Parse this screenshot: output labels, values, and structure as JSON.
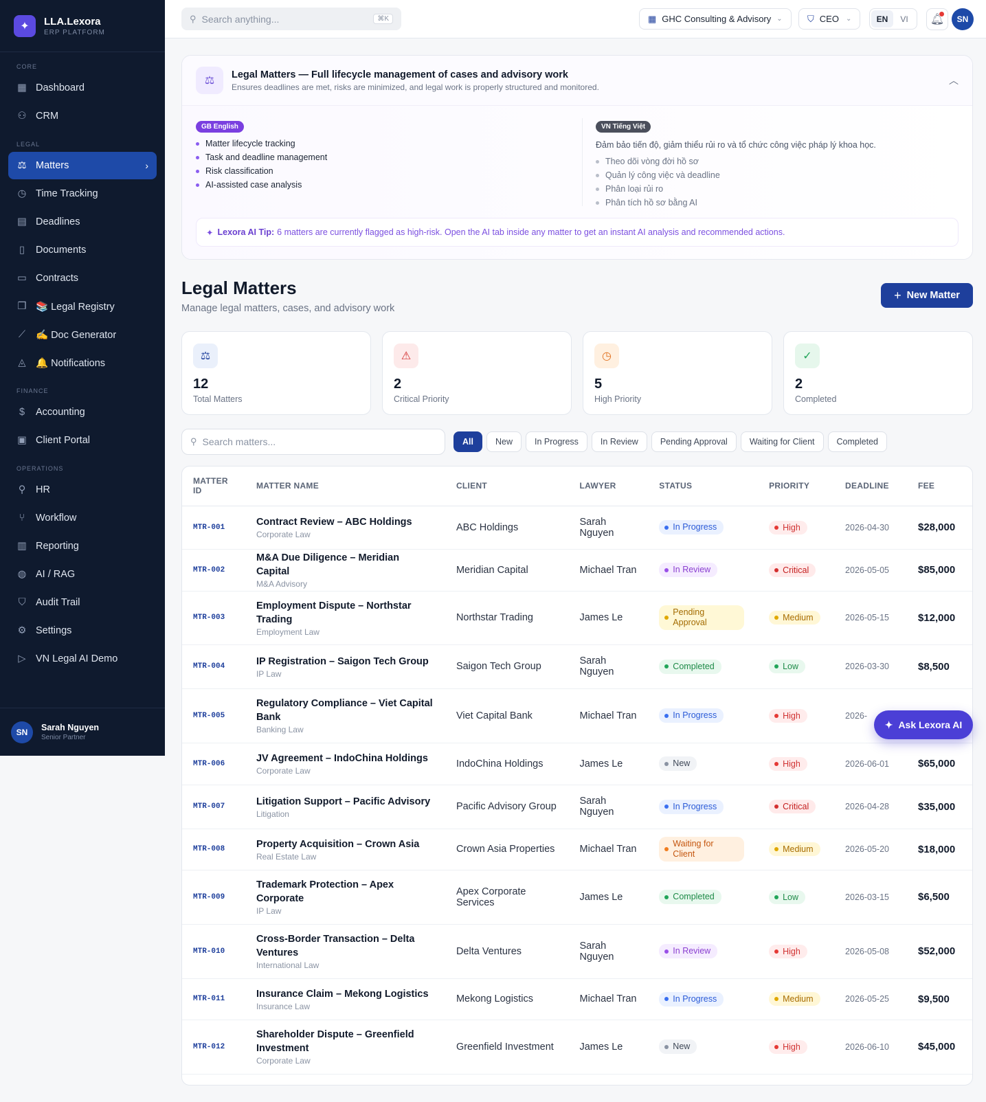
{
  "brand": {
    "name": "LLA.Lexora",
    "sub": "ERP PLATFORM"
  },
  "sidebar": {
    "sections": [
      {
        "title": "CORE",
        "items": [
          {
            "label": "Dashboard",
            "icon": "grid-icon"
          },
          {
            "label": "CRM",
            "icon": "users-icon"
          }
        ]
      },
      {
        "title": "LEGAL",
        "items": [
          {
            "label": "Matters",
            "icon": "scale-icon",
            "active": true
          },
          {
            "label": "Time Tracking",
            "icon": "clock-icon"
          },
          {
            "label": "Deadlines",
            "icon": "calendar-icon"
          },
          {
            "label": "Documents",
            "icon": "document-icon"
          },
          {
            "label": "Contracts",
            "icon": "file-icon"
          },
          {
            "label": "📚 Legal Registry",
            "icon": "book-icon"
          },
          {
            "label": "✍️ Doc Generator",
            "icon": "wand-icon"
          },
          {
            "label": "🔔 Notifications",
            "icon": "bell-icon"
          }
        ]
      },
      {
        "title": "FINANCE",
        "items": [
          {
            "label": "Accounting",
            "icon": "dollar-icon"
          },
          {
            "label": "Client Portal",
            "icon": "portal-icon"
          }
        ]
      },
      {
        "title": "OPERATIONS",
        "items": [
          {
            "label": "HR",
            "icon": "user-icon"
          },
          {
            "label": "Workflow",
            "icon": "workflow-icon"
          },
          {
            "label": "Reporting",
            "icon": "chart-icon"
          },
          {
            "label": "AI / RAG",
            "icon": "brain-icon"
          },
          {
            "label": "Audit Trail",
            "icon": "shield-icon"
          },
          {
            "label": "Settings",
            "icon": "gear-icon"
          },
          {
            "label": "VN Legal AI Demo",
            "icon": "play-icon"
          }
        ]
      }
    ],
    "user": {
      "initials": "SN",
      "name": "Sarah Nguyen",
      "role": "Senior Partner"
    }
  },
  "topbar": {
    "search_placeholder": "Search anything...",
    "shortcut": "⌘K",
    "company": "GHC Consulting & Advisory",
    "role": "CEO",
    "lang_en": "EN",
    "lang_vi": "VI",
    "avatar": "SN"
  },
  "info": {
    "title": "Legal Matters — Full lifecycle management of cases and advisory work",
    "subtitle": "Ensures deadlines are met, risks are minimized, and legal work is properly structured and monitored.",
    "en_badge": "GB English",
    "en_items": [
      "Matter lifecycle tracking",
      "Task and deadline management",
      "Risk classification",
      "AI-assisted case analysis"
    ],
    "vi_badge": "VN Tiếng Việt",
    "vi_intro": "Đảm bảo tiến độ, giảm thiểu rủi ro và tổ chức công việc pháp lý khoa học.",
    "vi_items": [
      "Theo dõi vòng đời hồ sơ",
      "Quản lý công việc và deadline",
      "Phân loại rủi ro",
      "Phân tích hồ sơ bằng AI"
    ],
    "tip_label": "Lexora AI Tip:",
    "tip_text": "6 matters are currently flagged as high-risk. Open the AI tab inside any matter to get an instant AI analysis and recommended actions."
  },
  "page": {
    "title": "Legal Matters",
    "subtitle": "Manage legal matters, cases, and advisory work",
    "new_button": "New Matter"
  },
  "stats": [
    {
      "value": "12",
      "label": "Total Matters"
    },
    {
      "value": "2",
      "label": "Critical Priority"
    },
    {
      "value": "5",
      "label": "High Priority"
    },
    {
      "value": "2",
      "label": "Completed"
    }
  ],
  "filters": {
    "search_placeholder": "Search matters...",
    "chips": [
      "All",
      "New",
      "In Progress",
      "In Review",
      "Pending Approval",
      "Waiting for Client",
      "Completed"
    ]
  },
  "table": {
    "headers": [
      "MATTER ID",
      "MATTER NAME",
      "CLIENT",
      "LAWYER",
      "STATUS",
      "PRIORITY",
      "DEADLINE",
      "FEE"
    ],
    "rows": [
      {
        "id": "MTR-001",
        "name": "Contract Review – ABC Holdings",
        "cat": "Corporate Law",
        "client": "ABC Holdings",
        "lawyer": "Sarah Nguyen",
        "status": "In Progress",
        "priority": "High",
        "deadline": "2026-04-30",
        "fee": "$28,000"
      },
      {
        "id": "MTR-002",
        "name": "M&A Due Diligence – Meridian Capital",
        "cat": "M&A Advisory",
        "client": "Meridian Capital",
        "lawyer": "Michael Tran",
        "status": "In Review",
        "priority": "Critical",
        "deadline": "2026-05-05",
        "fee": "$85,000"
      },
      {
        "id": "MTR-003",
        "name": "Employment Dispute – Northstar Trading",
        "cat": "Employment Law",
        "client": "Northstar Trading",
        "lawyer": "James Le",
        "status": "Pending Approval",
        "priority": "Medium",
        "deadline": "2026-05-15",
        "fee": "$12,000"
      },
      {
        "id": "MTR-004",
        "name": "IP Registration – Saigon Tech Group",
        "cat": "IP Law",
        "client": "Saigon Tech Group",
        "lawyer": "Sarah Nguyen",
        "status": "Completed",
        "priority": "Low",
        "deadline": "2026-03-30",
        "fee": "$8,500"
      },
      {
        "id": "MTR-005",
        "name": "Regulatory Compliance – Viet Capital Bank",
        "cat": "Banking Law",
        "client": "Viet Capital Bank",
        "lawyer": "Michael Tran",
        "status": "In Progress",
        "priority": "High",
        "deadline": "2026-",
        "fee": ""
      },
      {
        "id": "MTR-006",
        "name": "JV Agreement – IndoChina Holdings",
        "cat": "Corporate Law",
        "client": "IndoChina Holdings",
        "lawyer": "James Le",
        "status": "New",
        "priority": "High",
        "deadline": "2026-06-01",
        "fee": "$65,000"
      },
      {
        "id": "MTR-007",
        "name": "Litigation Support – Pacific Advisory",
        "cat": "Litigation",
        "client": "Pacific Advisory Group",
        "lawyer": "Sarah Nguyen",
        "status": "In Progress",
        "priority": "Critical",
        "deadline": "2026-04-28",
        "fee": "$35,000"
      },
      {
        "id": "MTR-008",
        "name": "Property Acquisition – Crown Asia",
        "cat": "Real Estate Law",
        "client": "Crown Asia Properties",
        "lawyer": "Michael Tran",
        "status": "Waiting for Client",
        "priority": "Medium",
        "deadline": "2026-05-20",
        "fee": "$18,000"
      },
      {
        "id": "MTR-009",
        "name": "Trademark Protection – Apex Corporate",
        "cat": "IP Law",
        "client": "Apex Corporate Services",
        "lawyer": "James Le",
        "status": "Completed",
        "priority": "Low",
        "deadline": "2026-03-15",
        "fee": "$6,500"
      },
      {
        "id": "MTR-010",
        "name": "Cross-Border Transaction – Delta Ventures",
        "cat": "International Law",
        "client": "Delta Ventures",
        "lawyer": "Sarah Nguyen",
        "status": "In Review",
        "priority": "High",
        "deadline": "2026-05-08",
        "fee": "$52,000"
      },
      {
        "id": "MTR-011",
        "name": "Insurance Claim – Mekong Logistics",
        "cat": "Insurance Law",
        "client": "Mekong Logistics",
        "lawyer": "Michael Tran",
        "status": "In Progress",
        "priority": "Medium",
        "deadline": "2026-05-25",
        "fee": "$9,500"
      },
      {
        "id": "MTR-012",
        "name": "Shareholder Dispute – Greenfield Investment",
        "cat": "Corporate Law",
        "client": "Greenfield Investment",
        "lawyer": "James Le",
        "status": "New",
        "priority": "High",
        "deadline": "2026-06-10",
        "fee": "$45,000"
      }
    ]
  },
  "ask_ai": "Ask Lexora AI"
}
